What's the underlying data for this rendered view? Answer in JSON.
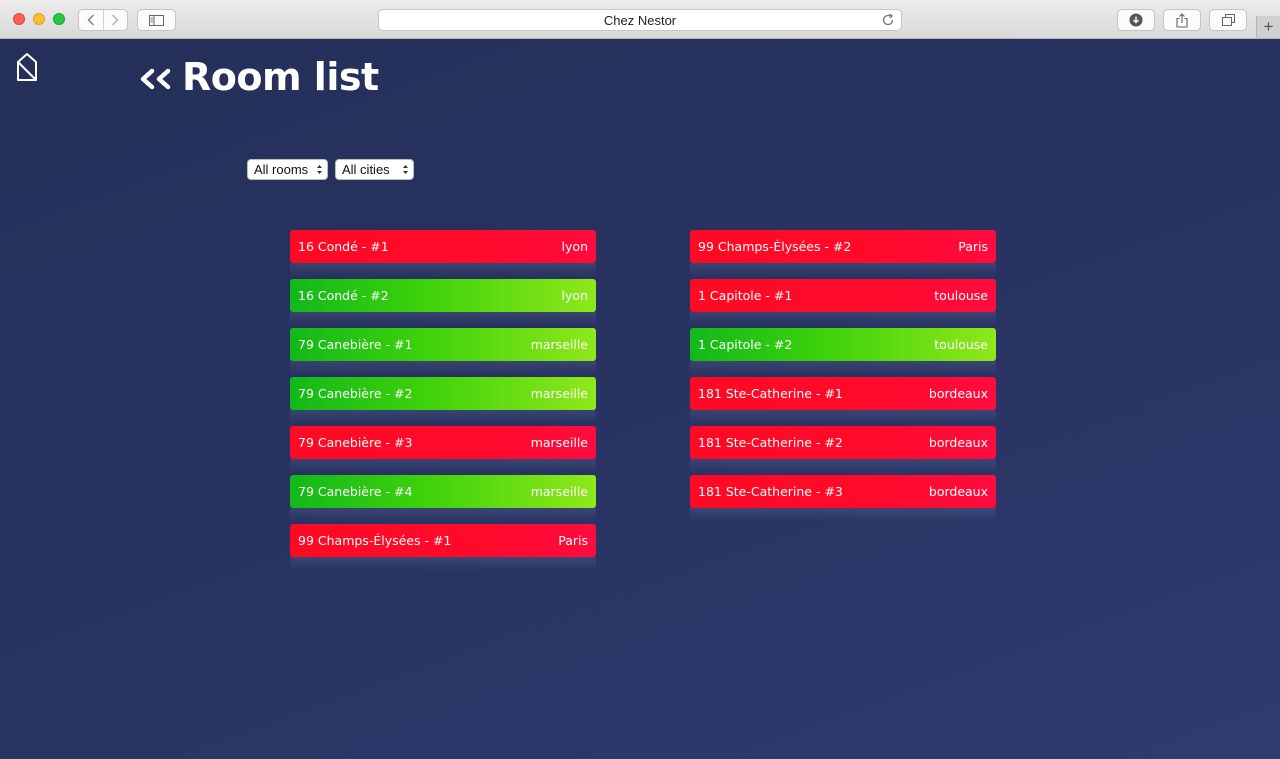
{
  "browser": {
    "url_title": "Chez Nestor",
    "new_tab_label": "+"
  },
  "page": {
    "title": "Room list",
    "filters": {
      "rooms_selected": "All rooms",
      "cities_selected": "All cities"
    }
  },
  "rooms": [
    {
      "name": "16 Condé - #1",
      "city": "lyon",
      "status": "occupied"
    },
    {
      "name": "16 Condé - #2",
      "city": "lyon",
      "status": "free"
    },
    {
      "name": "79 Canebière - #1",
      "city": "marseille",
      "status": "free"
    },
    {
      "name": "79 Canebière - #2",
      "city": "marseille",
      "status": "free"
    },
    {
      "name": "79 Canebière - #3",
      "city": "marseille",
      "status": "occupied"
    },
    {
      "name": "79 Canebière - #4",
      "city": "marseille",
      "status": "free"
    },
    {
      "name": "99 Champs-Élysées - #1",
      "city": "Paris",
      "status": "occupied"
    },
    {
      "name": "99 Champs-Élysées - #2",
      "city": "Paris",
      "status": "occupied"
    },
    {
      "name": "1 Capitole - #1",
      "city": "toulouse",
      "status": "occupied"
    },
    {
      "name": "1 Capitole - #2",
      "city": "toulouse",
      "status": "free"
    },
    {
      "name": "181 Ste-Catherine - #1",
      "city": "bordeaux",
      "status": "occupied"
    },
    {
      "name": "181 Ste-Catherine - #2",
      "city": "bordeaux",
      "status": "occupied"
    },
    {
      "name": "181 Ste-Catherine - #3",
      "city": "bordeaux",
      "status": "occupied"
    }
  ],
  "colors": {
    "occupied": "#ff0a24",
    "free": "#3fd20b",
    "background": "#283362"
  }
}
